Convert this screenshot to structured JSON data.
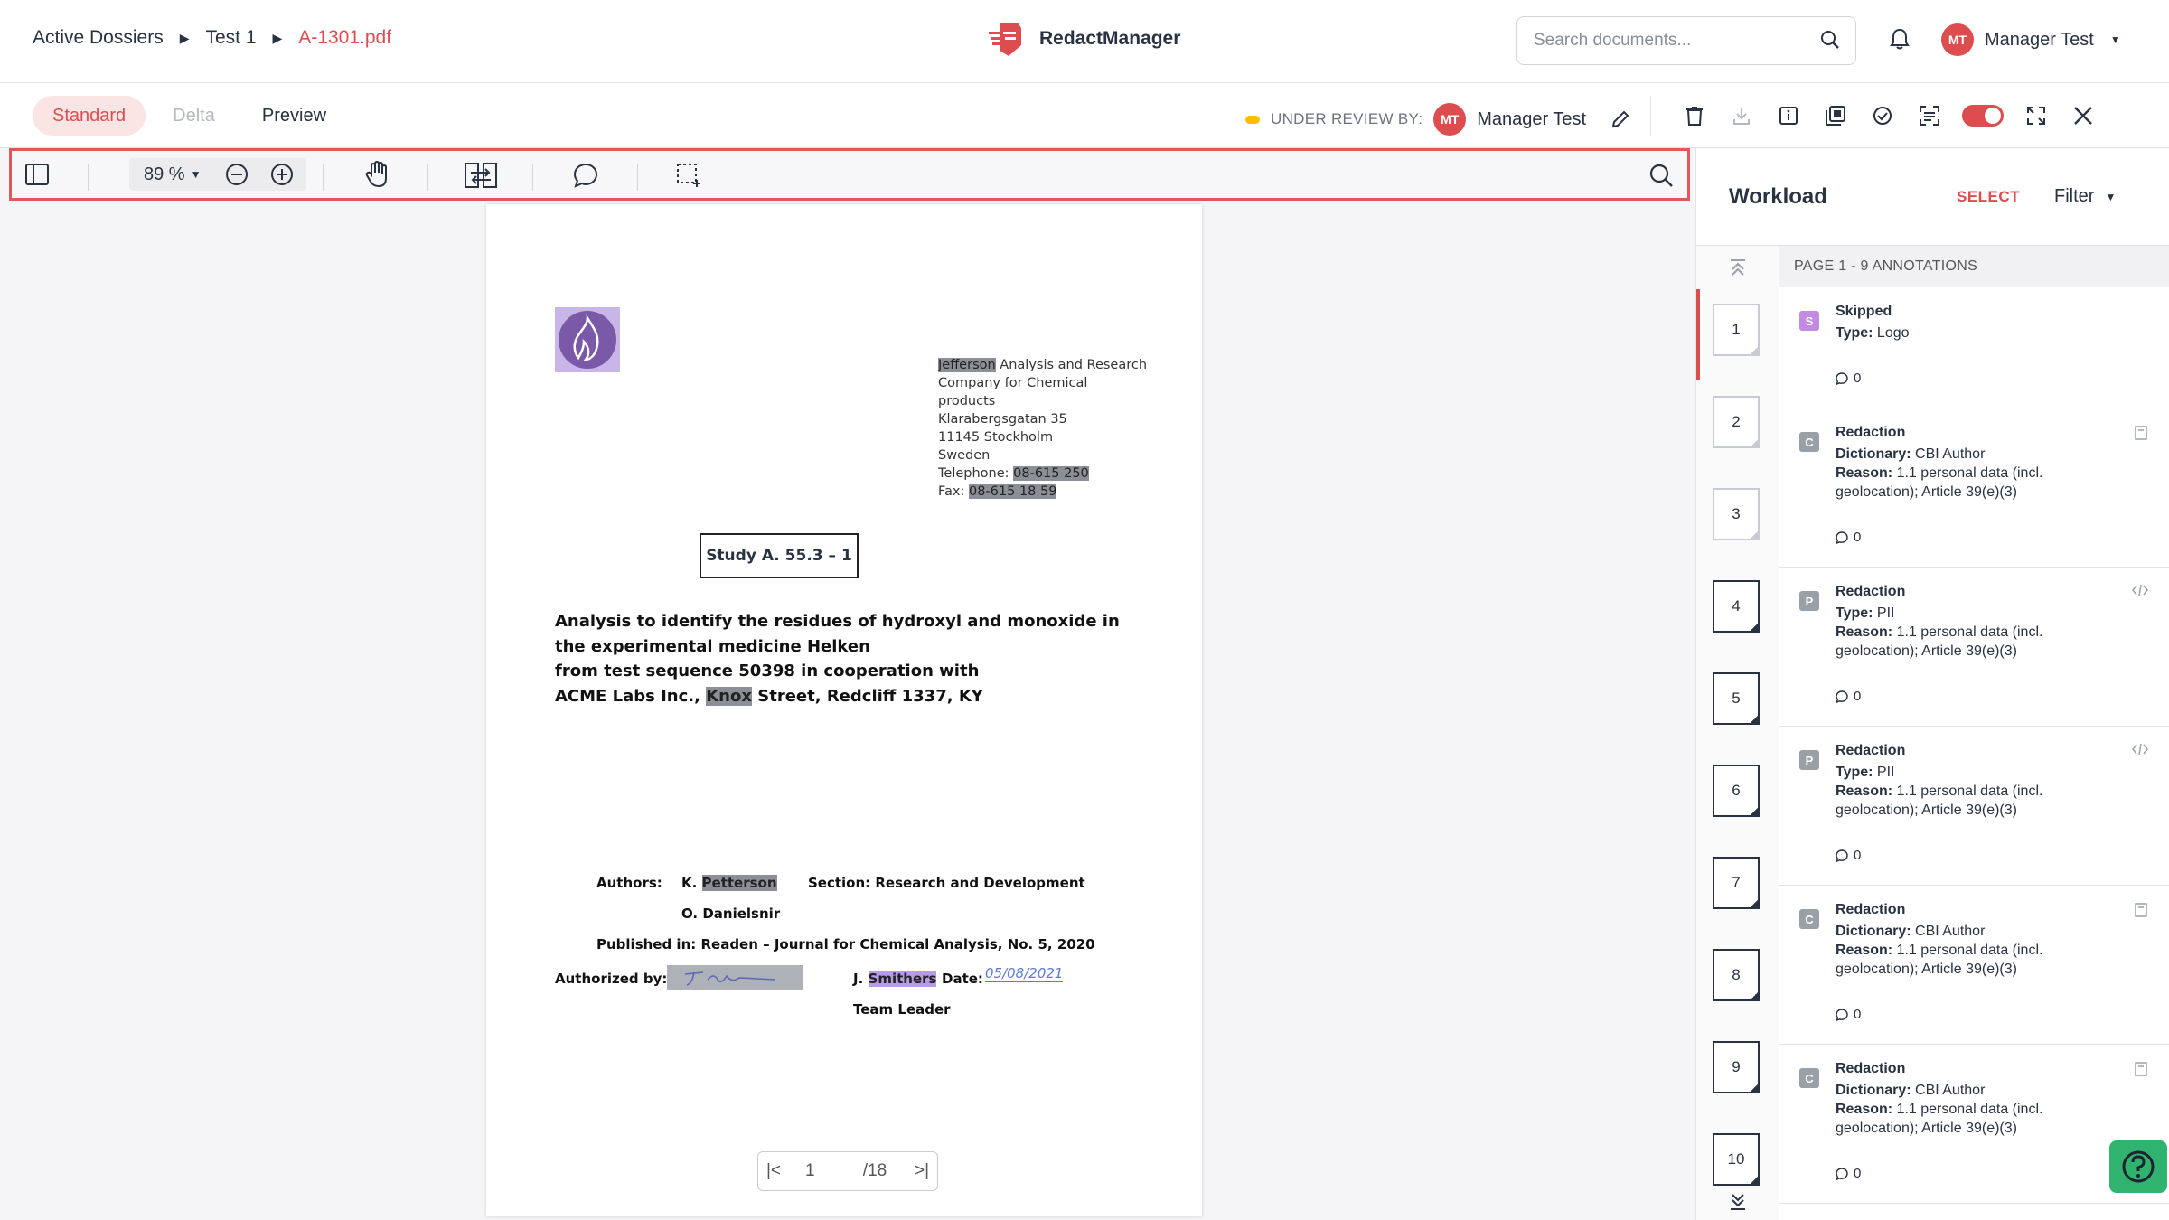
{
  "breadcrumb": {
    "items": [
      "Active Dossiers",
      "Test 1",
      "A-1301.pdf"
    ]
  },
  "brand": {
    "name": "RedactManager"
  },
  "search": {
    "placeholder": "Search documents..."
  },
  "user": {
    "initials": "MT",
    "name": "Manager Test"
  },
  "tabs": [
    {
      "label": "Standard",
      "state": "active"
    },
    {
      "label": "Delta",
      "state": "disabled"
    },
    {
      "label": "Preview",
      "state": "normal"
    }
  ],
  "review": {
    "label": "UNDER REVIEW BY:",
    "initials": "MT",
    "name": "Manager Test",
    "status_color": "#fdbd00"
  },
  "viewer_toolbar": {
    "zoom": "89 %"
  },
  "document": {
    "address": {
      "company_highlight": "Jefferson",
      "company_rest": " Analysis and Research",
      "line2": "Company for Chemical",
      "line3": "products",
      "line4": "Klarabergsgatan 35",
      "line5": "11145 Stockholm",
      "line6": "Sweden",
      "tel_label": "Telephone: ",
      "tel": "08-615 250",
      "fax_label": "Fax: ",
      "fax": "08-615 18 59"
    },
    "study": "Study A. 55.3 – 1",
    "title_lines": [
      "Analysis to identify the residues of hydroxyl and monoxide in",
      "the experimental medicine Helken",
      "from test sequence 50398 in cooperation with"
    ],
    "title_last_pre": "ACME Labs Inc., ",
    "title_last_hl": "Knox",
    "title_last_post": " Street, Redcliff 1337, KY",
    "authors_label": "Authors:",
    "author1_initial": "K. ",
    "author1_name": "Petterson",
    "section": "Section: Research and Development",
    "author2": "O. Danielsnir",
    "published": "Published in: Readen – Journal for Chemical Analysis, No. 5, 2020",
    "authorized_label": "Authorized by:",
    "signer_initial": "J. ",
    "signer_name": "Smithers",
    "date_label": "Date:",
    "date_value": "05/08/2021",
    "team_leader": "Team Leader"
  },
  "pager": {
    "current": "1",
    "total": "/18"
  },
  "panel": {
    "title": "Workload",
    "select": "SELECT",
    "filter": "Filter",
    "annotations_header": "PAGE 1 - 9 ANNOTATIONS",
    "thumb_pages": [
      "1",
      "2",
      "3",
      "4",
      "5",
      "6",
      "7",
      "8",
      "9",
      "10"
    ],
    "annotations": [
      {
        "badge": "S",
        "badge_color": "#c28ae0",
        "title": "Skipped",
        "k1": "Type:",
        "v1": " Logo",
        "reason_k": "",
        "reason_v": "",
        "comments": "0"
      },
      {
        "badge": "C",
        "badge_color": "#9aa0a8",
        "title": "Redaction",
        "k1": "Dictionary:",
        "v1": " CBI Author",
        "reason_k": "Reason:",
        "reason_v": " 1.1 personal data (incl. geolocation); Article 39(e)(3)",
        "comments": "0"
      },
      {
        "badge": "P",
        "badge_color": "#9aa0a8",
        "title": "Redaction",
        "k1": "Type:",
        "v1": " PII",
        "reason_k": "Reason:",
        "reason_v": " 1.1 personal data (incl. geolocation); Article 39(e)(3)",
        "comments": "0"
      },
      {
        "badge": "P",
        "badge_color": "#9aa0a8",
        "title": "Redaction",
        "k1": "Type:",
        "v1": " PII",
        "reason_k": "Reason:",
        "reason_v": " 1.1 personal data (incl. geolocation); Article 39(e)(3)",
        "comments": "0"
      },
      {
        "badge": "C",
        "badge_color": "#9aa0a8",
        "title": "Redaction",
        "k1": "Dictionary:",
        "v1": " CBI Author",
        "reason_k": "Reason:",
        "reason_v": " 1.1 personal data (incl. geolocation); Article 39(e)(3)",
        "comments": "0"
      },
      {
        "badge": "C",
        "badge_color": "#9aa0a8",
        "title": "Redaction",
        "k1": "Dictionary:",
        "v1": " CBI Author",
        "reason_k": "Reason:",
        "reason_v": " 1.1 personal data (incl. geolocation); Article 39(e)(3)",
        "comments": "0"
      }
    ]
  },
  "colors": {
    "accent": "#dd4d50",
    "help": "#2fb36f"
  }
}
